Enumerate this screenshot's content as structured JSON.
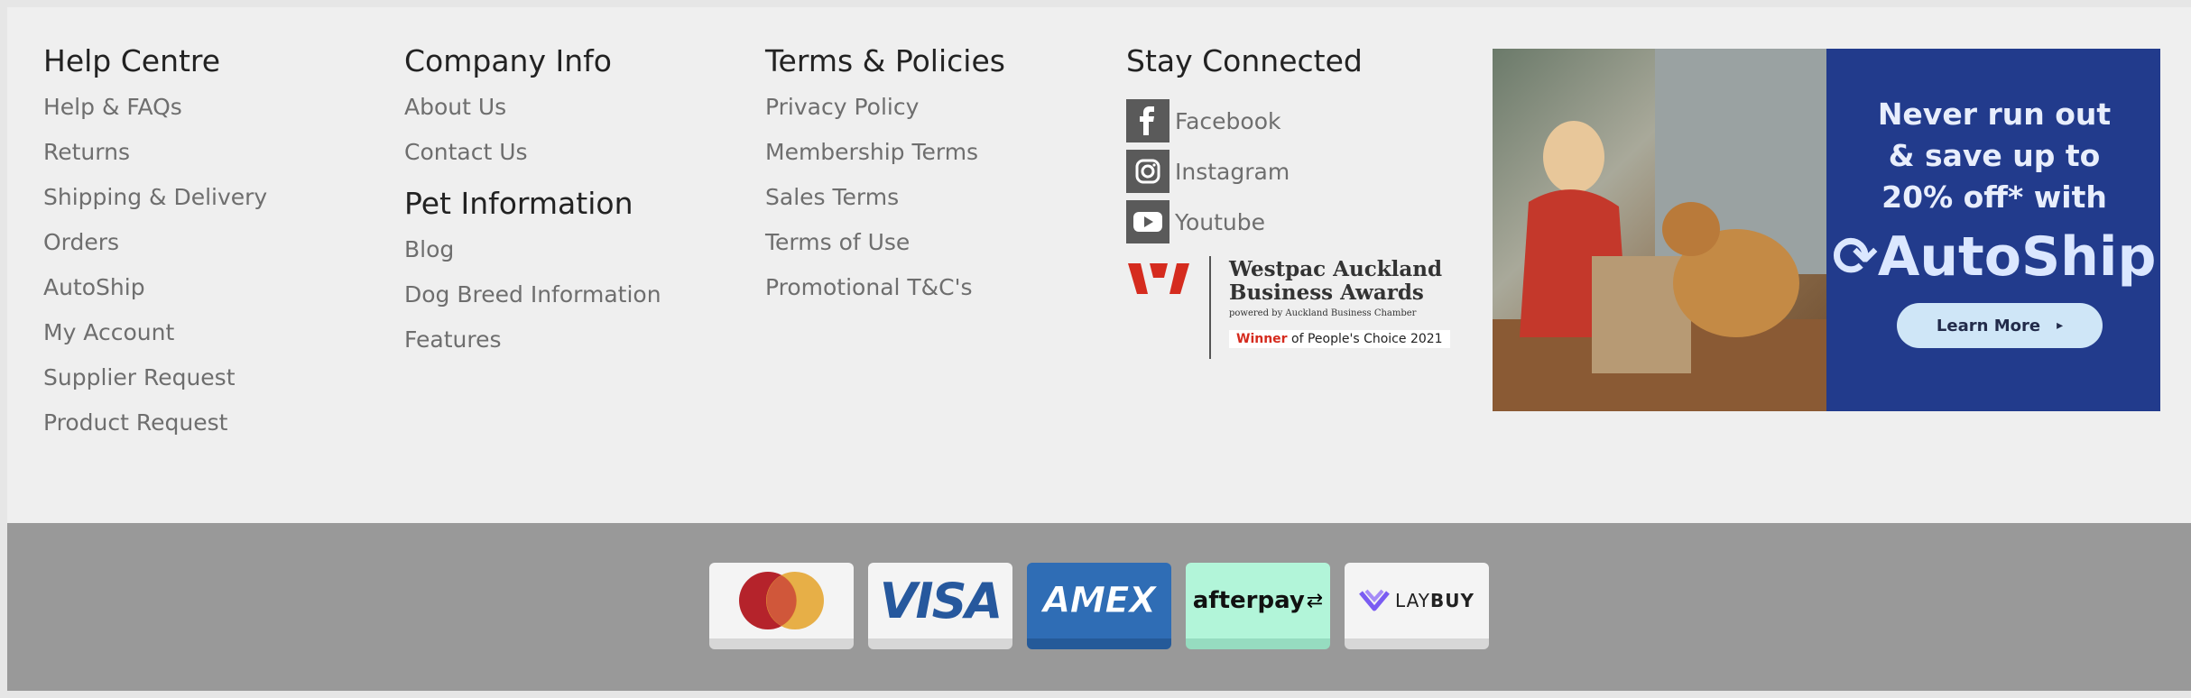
{
  "help_centre": {
    "heading": "Help Centre",
    "links": [
      "Help & FAQs",
      "Returns",
      "Shipping & Delivery",
      "Orders",
      "AutoShip",
      "My Account",
      "Supplier Request",
      "Product Request"
    ]
  },
  "company_info": {
    "heading": "Company Info",
    "links": [
      "About Us",
      "Contact Us"
    ]
  },
  "pet_information": {
    "heading": "Pet Information",
    "links": [
      "Blog",
      "Dog Breed Information",
      "Features"
    ]
  },
  "terms_policies": {
    "heading": "Terms & Policies",
    "links": [
      "Privacy Policy",
      "Membership Terms",
      "Sales Terms",
      "Terms of Use",
      "Promotional T&C's"
    ]
  },
  "stay_connected": {
    "heading": "Stay Connected",
    "social": [
      {
        "label": "Facebook",
        "icon": "facebook-icon"
      },
      {
        "label": "Instagram",
        "icon": "instagram-icon"
      },
      {
        "label": "Youtube",
        "icon": "youtube-icon"
      }
    ],
    "award": {
      "title_line1": "Westpac Auckland",
      "title_line2": "Business Awards",
      "powered": "powered by Auckland Business Chamber",
      "winner": "Winner",
      "of_text": "of People's Choice 2021",
      "brand_color": "#d52b1e"
    }
  },
  "promo": {
    "line1": "Never run out",
    "line2": "& save up to",
    "line3": "20% off* with",
    "brand": "AutoShip",
    "button": "Learn More",
    "background": "#223b8c"
  },
  "payment_methods": [
    {
      "name": "Mastercard",
      "icon": "mastercard-icon"
    },
    {
      "name": "VISA",
      "icon": "visa-icon"
    },
    {
      "name": "AMEX",
      "icon": "amex-icon"
    },
    {
      "name": "afterpay",
      "icon": "afterpay-icon"
    },
    {
      "name": "LAYBUY",
      "icon": "laybuy-icon",
      "part1": "LAY",
      "part2": "BUY"
    }
  ]
}
